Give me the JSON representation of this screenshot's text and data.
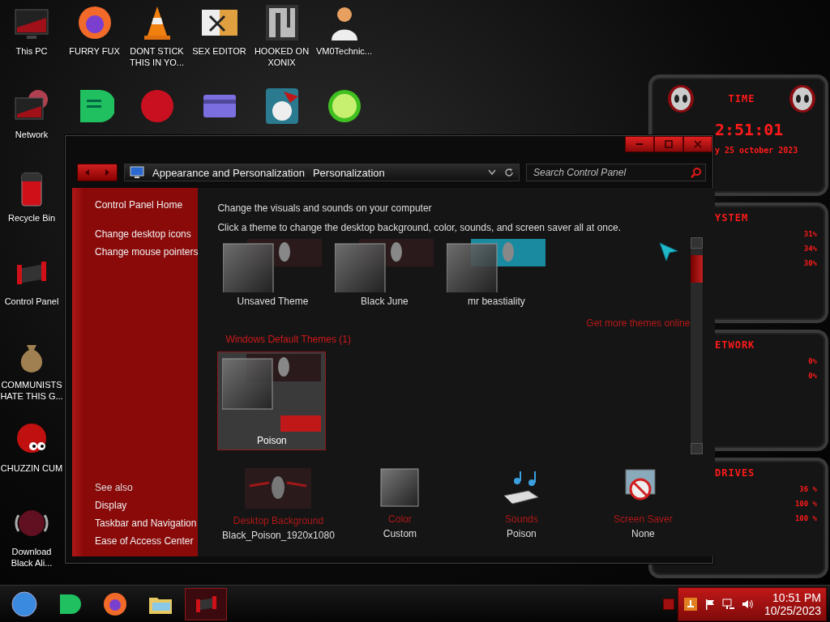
{
  "desktop_icons": [
    {
      "label": "This PC"
    },
    {
      "label": "FURRY FUX"
    },
    {
      "label": "DONT STICK THIS IN YO..."
    },
    {
      "label": "SEX EDITOR"
    },
    {
      "label": "HOOKED ON XONIX"
    },
    {
      "label": "VM0Technic..."
    },
    {
      "label": "Network"
    },
    {
      "label": "Recycle Bin"
    },
    {
      "label": "Control Panel"
    },
    {
      "label": "COMMUNISTS HATE THIS G..."
    },
    {
      "label": "CHUZZIN CUM"
    },
    {
      "label": "Download Black Ali..."
    }
  ],
  "gadget": {
    "time_title": "TIME",
    "time": "2:51:01",
    "date": "y 25 october 2023",
    "system_title": "YSTEM",
    "system_readings": [
      "31%",
      "34%",
      "30%"
    ],
    "network_title": "ETWORK",
    "network_readings": [
      "0%",
      "0%"
    ],
    "drives_title": "DRIVES",
    "drives_readings": [
      "36 %",
      "100 %",
      "100 %"
    ]
  },
  "window": {
    "address": [
      "Appearance and Personalization",
      "Personalization"
    ],
    "search": {
      "placeholder": "Search Control Panel"
    },
    "sidebar": {
      "links": [
        "Control Panel Home",
        "Change desktop icons",
        "Change mouse pointers"
      ],
      "see_also_heading": "See also",
      "see_also": [
        "Display",
        "Taskbar and Navigation",
        "Ease of Access Center"
      ]
    },
    "content": {
      "title": "Change the visuals and sounds on your computer",
      "description": "Click a theme to change the desktop background, color, sounds, and screen saver all at once.",
      "my_themes": [
        {
          "name": "Unsaved Theme",
          "selected": false
        },
        {
          "name": "Black June",
          "selected": false
        },
        {
          "name": "mr beastiality",
          "selected": false
        }
      ],
      "more_link": "Get more themes online",
      "default_heading": "Windows Default Themes (1)",
      "default_themes": [
        {
          "name": "Poison",
          "selected": true
        }
      ],
      "settings": [
        {
          "kind": "background",
          "label": "Desktop Background",
          "value": "Black_Poison_1920x1080"
        },
        {
          "kind": "color",
          "label": "Color",
          "value": "Custom"
        },
        {
          "kind": "sounds",
          "label": "Sounds",
          "value": "Poison"
        },
        {
          "kind": "saver",
          "label": "Screen Saver",
          "value": "None"
        }
      ]
    }
  },
  "taskbar": {
    "items": [
      {
        "selected": false
      },
      {
        "selected": false
      },
      {
        "selected": false
      },
      {
        "selected": false
      },
      {
        "selected": true
      }
    ],
    "clock": {
      "time": "10:51 PM",
      "date": "10/25/2023"
    }
  }
}
